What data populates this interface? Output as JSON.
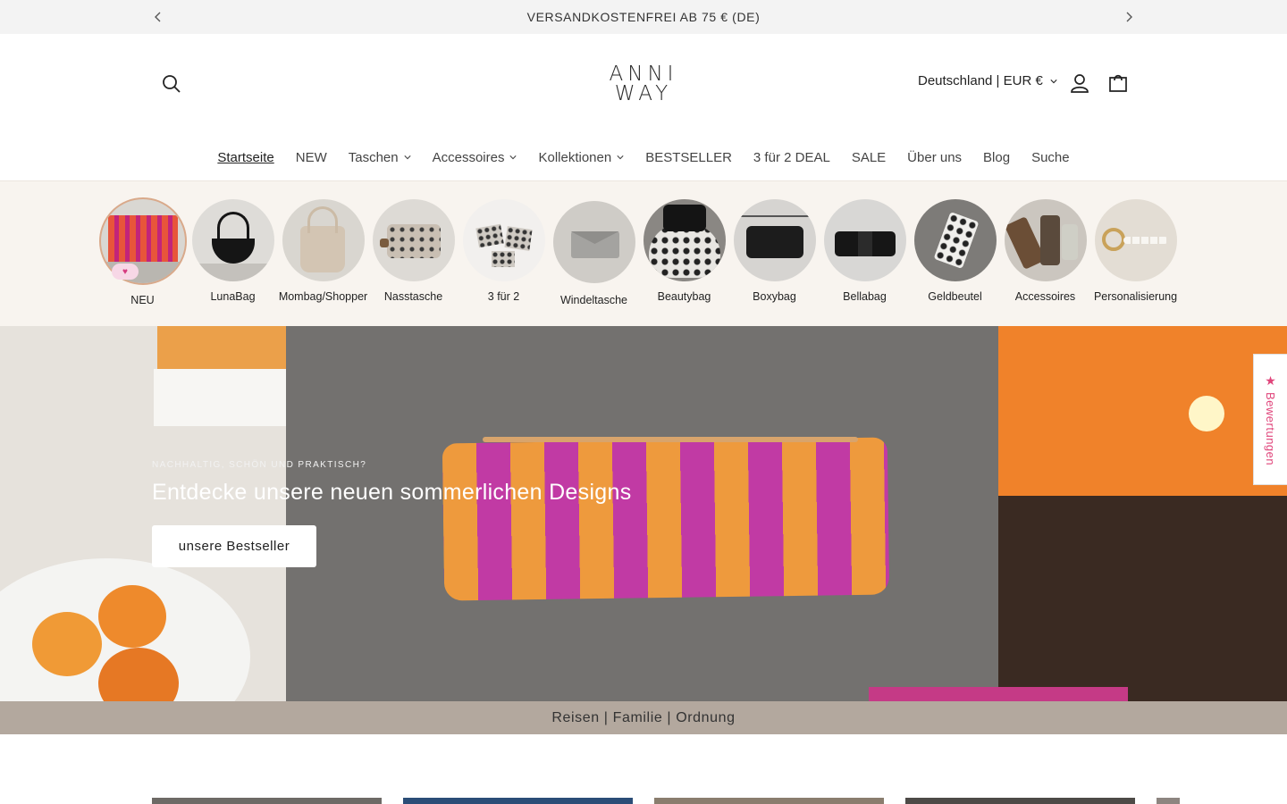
{
  "announcement": {
    "text": "VERSANDKOSTENFREI AB 75 € (DE)",
    "prev_icon": "chevron-left-icon",
    "next_icon": "chevron-right-icon"
  },
  "header": {
    "logo_line1": "ANNI",
    "logo_line2": "WAY",
    "locale": "Deutschland | EUR €",
    "icons": [
      "search-icon",
      "account-icon",
      "cart-icon"
    ]
  },
  "nav": {
    "items": [
      {
        "label": "Startseite",
        "active": true,
        "dropdown": false
      },
      {
        "label": "NEW",
        "dropdown": false
      },
      {
        "label": "Taschen",
        "dropdown": true
      },
      {
        "label": "Accessoires",
        "dropdown": true
      },
      {
        "label": "Kollektionen",
        "dropdown": true
      },
      {
        "label": "BESTSELLER",
        "dropdown": false
      },
      {
        "label": "3 für 2 DEAL",
        "dropdown": false
      },
      {
        "label": "SALE",
        "dropdown": false
      },
      {
        "label": "Über uns",
        "dropdown": false
      },
      {
        "label": "Blog",
        "dropdown": false
      },
      {
        "label": "Suche",
        "dropdown": false
      }
    ]
  },
  "categories": [
    {
      "label": "NEU"
    },
    {
      "label": "LunaBag"
    },
    {
      "label": "Mombag/Shopper"
    },
    {
      "label": "Nasstasche"
    },
    {
      "label": "3 für 2"
    },
    {
      "label": "Windeltasche"
    },
    {
      "label": "Beautybag"
    },
    {
      "label": "Boxybag"
    },
    {
      "label": "Bellabag"
    },
    {
      "label": "Geldbeutel"
    },
    {
      "label": "Accessoires"
    },
    {
      "label": "Personalisierung"
    }
  ],
  "hero": {
    "eyebrow": "NACHHALTIG, SCHÖN UND PRAKTISCH?",
    "title": "Entdecke unsere neuen sommerlichen Designs",
    "button": "unsere Bestseller"
  },
  "tagline": "Reisen | Familie | Ordnung",
  "reviews_tab": {
    "label": "Bewertungen",
    "icon": "star-icon"
  },
  "colors": {
    "accent_pink": "#e0457b",
    "tagline_bg": "#b3a89e",
    "strip_bg": "#f8f4ef"
  }
}
